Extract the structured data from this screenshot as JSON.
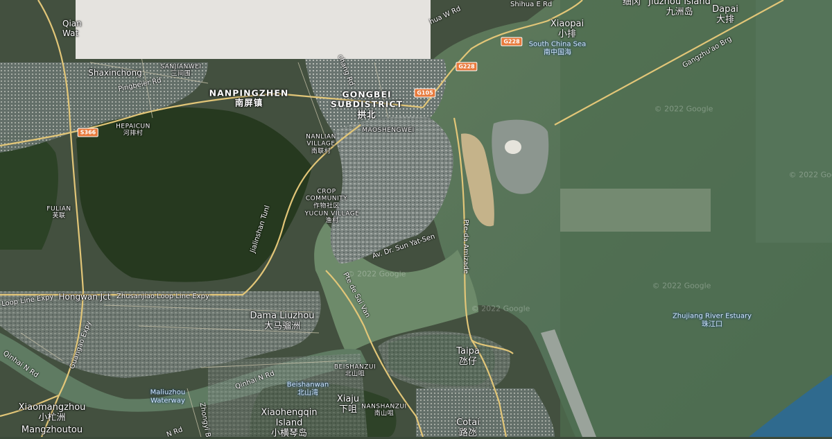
{
  "places": [
    {
      "id": "nanpingzhen",
      "en": "NANPINGZHEN",
      "zh": "南屏镇",
      "cls": "district"
    },
    {
      "id": "gongbei",
      "en": "GONGBEI",
      "en2": "SUBDISTRICT",
      "zh": "拱北",
      "cls": "district"
    },
    {
      "id": "xiaopai",
      "en": "Xiaopai",
      "zh": "小排",
      "cls": "big"
    },
    {
      "id": "jiuzhou",
      "en": "Jiuzhou Island",
      "zh": "九洲岛",
      "cls": "big"
    },
    {
      "id": "dapai",
      "en": "Dapai",
      "zh": "大排",
      "cls": "big"
    },
    {
      "id": "xiwan",
      "zh": "细冈",
      "cls": "big"
    },
    {
      "id": "sanjianwei",
      "en": "SANJIANWEI",
      "zh": "三间围",
      "cls": "sm"
    },
    {
      "id": "hepaicun",
      "en": "HEPAICUN",
      "zh": "河排村",
      "cls": "sm"
    },
    {
      "id": "maoshengwei",
      "en": "MAOSHENGWEI",
      "cls": "sm"
    },
    {
      "id": "nanlian",
      "en": "NANLIAN",
      "en2": "VILLAGE",
      "zh": "南联村",
      "cls": "sm"
    },
    {
      "id": "crop",
      "en": "CROP",
      "en2": "COMMUNITY",
      "zh": "作物社区",
      "cls": "sm"
    },
    {
      "id": "yucun",
      "en": "YUCUN VILLAGE",
      "zh": "渔村",
      "cls": "sm"
    },
    {
      "id": "fulian",
      "en": "FULIAN",
      "zh": "芙联",
      "cls": "sm"
    },
    {
      "id": "shaxinchong",
      "en": "Shaxinchong",
      "cls": "med"
    },
    {
      "id": "dama",
      "en": "Dama Liuzhou",
      "zh": "大马骝洲",
      "cls": "big"
    },
    {
      "id": "beishanzui",
      "en": "BEISHANZUI",
      "zh": "北山咀",
      "cls": "sm"
    },
    {
      "id": "xiaju",
      "en": "Xiaju",
      "zh": "下咀",
      "cls": "big"
    },
    {
      "id": "nanshanzui",
      "en": "NANSHANZUI",
      "zh": "南山咀",
      "cls": "sm"
    },
    {
      "id": "xiaohengqin",
      "en": "Xiaohengqin",
      "en2": "Island",
      "zh": "小横琴岛",
      "cls": "big"
    },
    {
      "id": "xiaomangzhou",
      "en": "Xiaomangzhou",
      "zh": "小杧洲",
      "cls": "big"
    },
    {
      "id": "mangzhoutou",
      "en": "Mangzhoutou",
      "cls": "big"
    },
    {
      "id": "taipa",
      "en": "Taipa",
      "zh": "氹仔",
      "cls": "big"
    },
    {
      "id": "cotai",
      "en": "Cotai",
      "zh": "路氹",
      "cls": "big"
    },
    {
      "id": "hongwanjct",
      "en": "Hongwan Jct",
      "cls": "med"
    },
    {
      "id": "qian",
      "en": "Qian",
      "en2": "Wat",
      "cls": "med"
    }
  ],
  "water": [
    {
      "id": "scs",
      "en": "South China Sea",
      "zh": "南中国海"
    },
    {
      "id": "zhujiang",
      "en": "Zhujiang River Estuary",
      "zh": "珠江口"
    },
    {
      "id": "beishanwan",
      "en": "Beishanwan",
      "zh": "北山湾"
    },
    {
      "id": "maliuzhou",
      "en": "Maliuzhou",
      "en2": "Waterway"
    }
  ],
  "roads": [
    {
      "id": "r1",
      "text": "Shihua E Rd"
    },
    {
      "id": "r2",
      "text": "hua W Rd"
    },
    {
      "id": "r3",
      "text": "Pingbeier Rd"
    },
    {
      "id": "r4",
      "text": "Gangzhu'ao Brg"
    },
    {
      "id": "r5",
      "text": "Jialinshan Tunl"
    },
    {
      "id": "r6",
      "text": "Pte-da Amizade"
    },
    {
      "id": "r7",
      "text": "Av. Dr. Sun Yat-Sen"
    },
    {
      "id": "r8",
      "text": "Pte de Sai Van"
    },
    {
      "id": "r9",
      "text": "Loop Line Expy"
    },
    {
      "id": "r10",
      "text": "Zhusanjiao Loop Line Expy"
    },
    {
      "id": "r11",
      "text": "Guangao Expy"
    },
    {
      "id": "r12",
      "text": "Qinhai N Rd"
    },
    {
      "id": "r13",
      "text": "Qinhai N Rd"
    },
    {
      "id": "r14",
      "text": "Zhongyi B"
    },
    {
      "id": "r15",
      "text": "N Rd"
    },
    {
      "id": "r16",
      "text": "chang Rd"
    }
  ],
  "shields": [
    {
      "id": "s1",
      "text": "G228"
    },
    {
      "id": "s2",
      "text": "G228"
    },
    {
      "id": "s3",
      "text": "G105"
    },
    {
      "id": "s4",
      "text": "S366"
    }
  ],
  "watermark": "© 2022 Google",
  "colors": {
    "land": "#3b4a36",
    "forest": "#25381f",
    "sea": "#5e7a5c",
    "bay": "#6f8a6c",
    "ocean": "#2f6a8e",
    "road": "#e2c678",
    "urban": "#7d8a86"
  }
}
